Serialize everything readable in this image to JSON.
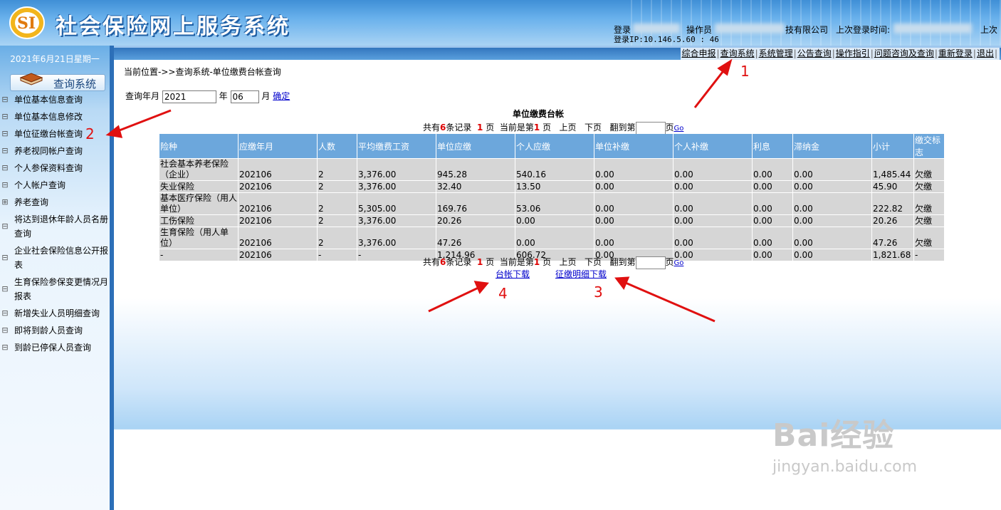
{
  "header": {
    "title": "社会保险网上服务系统",
    "login_label": "登录",
    "operator_label": "操作员",
    "company_suffix": "技有限公司",
    "last_login_label": "上次登录时间:",
    "last_login_suffix": "上次",
    "login_ip": "登录IP:10.146.5.60 :  46"
  },
  "sidebar": {
    "date": "2021年6月21日星期一",
    "section_title": "查询系统",
    "items": [
      {
        "label": "单位基本信息查询",
        "expander": "⊟"
      },
      {
        "label": "单位基本信息修改",
        "expander": "⊟"
      },
      {
        "label": "单位征缴台帐查询",
        "expander": "⊟"
      },
      {
        "label": "养老视同帐户查询",
        "expander": "⊟"
      },
      {
        "label": "个人参保资料查询",
        "expander": "⊟"
      },
      {
        "label": "个人帐户查询",
        "expander": "⊟"
      },
      {
        "label": "养老查询",
        "expander": "⊞"
      },
      {
        "label": "将达到退休年龄人员名册查询",
        "expander": "⊟"
      },
      {
        "label": "企业社会保险信息公开报表",
        "expander": "⊟"
      },
      {
        "label": "生育保险参保变更情况月报表",
        "expander": "⊟"
      },
      {
        "label": "新增失业人员明细查询",
        "expander": "⊟"
      },
      {
        "label": "即将到龄人员查询",
        "expander": "⊟"
      },
      {
        "label": "到龄已停保人员查询",
        "expander": "⊟"
      }
    ]
  },
  "menu": {
    "items": [
      "综合申报",
      "查询系统",
      "系统管理",
      "公告查询",
      "操作指引",
      "问题咨询及查询",
      "重新登录",
      "退出"
    ]
  },
  "main": {
    "breadcrumb": "当前位置->>查询系统-单位缴费台帐查询",
    "query": {
      "label_year_month": "查询年月",
      "year_value": "2021",
      "year_unit": "年",
      "month_value": "06",
      "month_unit": "月",
      "confirm": "确定"
    },
    "table_title": "单位缴费台帐",
    "pager": {
      "total_prefix": "共有",
      "total_count": "6",
      "total_suffix": "条记录",
      "pages": "1",
      "page_unit": "页",
      "current_prefix": "当前是第",
      "current_page": "1",
      "prev": "上页",
      "next": "下页",
      "jump_prefix": "翻到第",
      "jump_suffix": "页",
      "go": "Go"
    },
    "columns": [
      "险种",
      "应缴年月",
      "人数",
      "平均缴费工资",
      "单位应缴",
      "个人应缴",
      "单位补缴",
      "个人补缴",
      "利息",
      "滞纳金",
      "小计",
      "缴交标志"
    ],
    "rows": [
      [
        "社会基本养老保险（企业）",
        "202106",
        "2",
        "3,376.00",
        "945.28",
        "540.16",
        "0.00",
        "0.00",
        "0.00",
        "0.00",
        "1,485.44",
        "欠缴"
      ],
      [
        "失业保险",
        "202106",
        "2",
        "3,376.00",
        "32.40",
        "13.50",
        "0.00",
        "0.00",
        "0.00",
        "0.00",
        "45.90",
        "欠缴"
      ],
      [
        "基本医疗保险（用人单位）",
        "202106",
        "2",
        "5,305.00",
        "169.76",
        "53.06",
        "0.00",
        "0.00",
        "0.00",
        "0.00",
        "222.82",
        "欠缴"
      ],
      [
        "工伤保险",
        "202106",
        "2",
        "3,376.00",
        "20.26",
        "0.00",
        "0.00",
        "0.00",
        "0.00",
        "0.00",
        "20.26",
        "欠缴"
      ],
      [
        "生育保险（用人单位）",
        "202106",
        "2",
        "3,376.00",
        "47.26",
        "0.00",
        "0.00",
        "0.00",
        "0.00",
        "0.00",
        "47.26",
        "欠缴"
      ],
      [
        "-",
        "202106",
        "-",
        "-",
        "1,214.96",
        "606.72",
        "0.00",
        "0.00",
        "0.00",
        "0.00",
        "1,821.68",
        "-"
      ]
    ],
    "downloads": {
      "ledger": "台帐下载",
      "detail": "征缴明细下载"
    }
  },
  "annotations": [
    "1",
    "2",
    "3",
    "4"
  ],
  "watermark": {
    "brand": "Bai经验",
    "url": "jingyan.baidu.com"
  },
  "colors": {
    "header_blue": "#3f8fd6",
    "table_header": "#6ca7dc",
    "row_gray": "#d6d6d6",
    "arrow_red": "#e01010",
    "link_blue": "#0000cc"
  }
}
